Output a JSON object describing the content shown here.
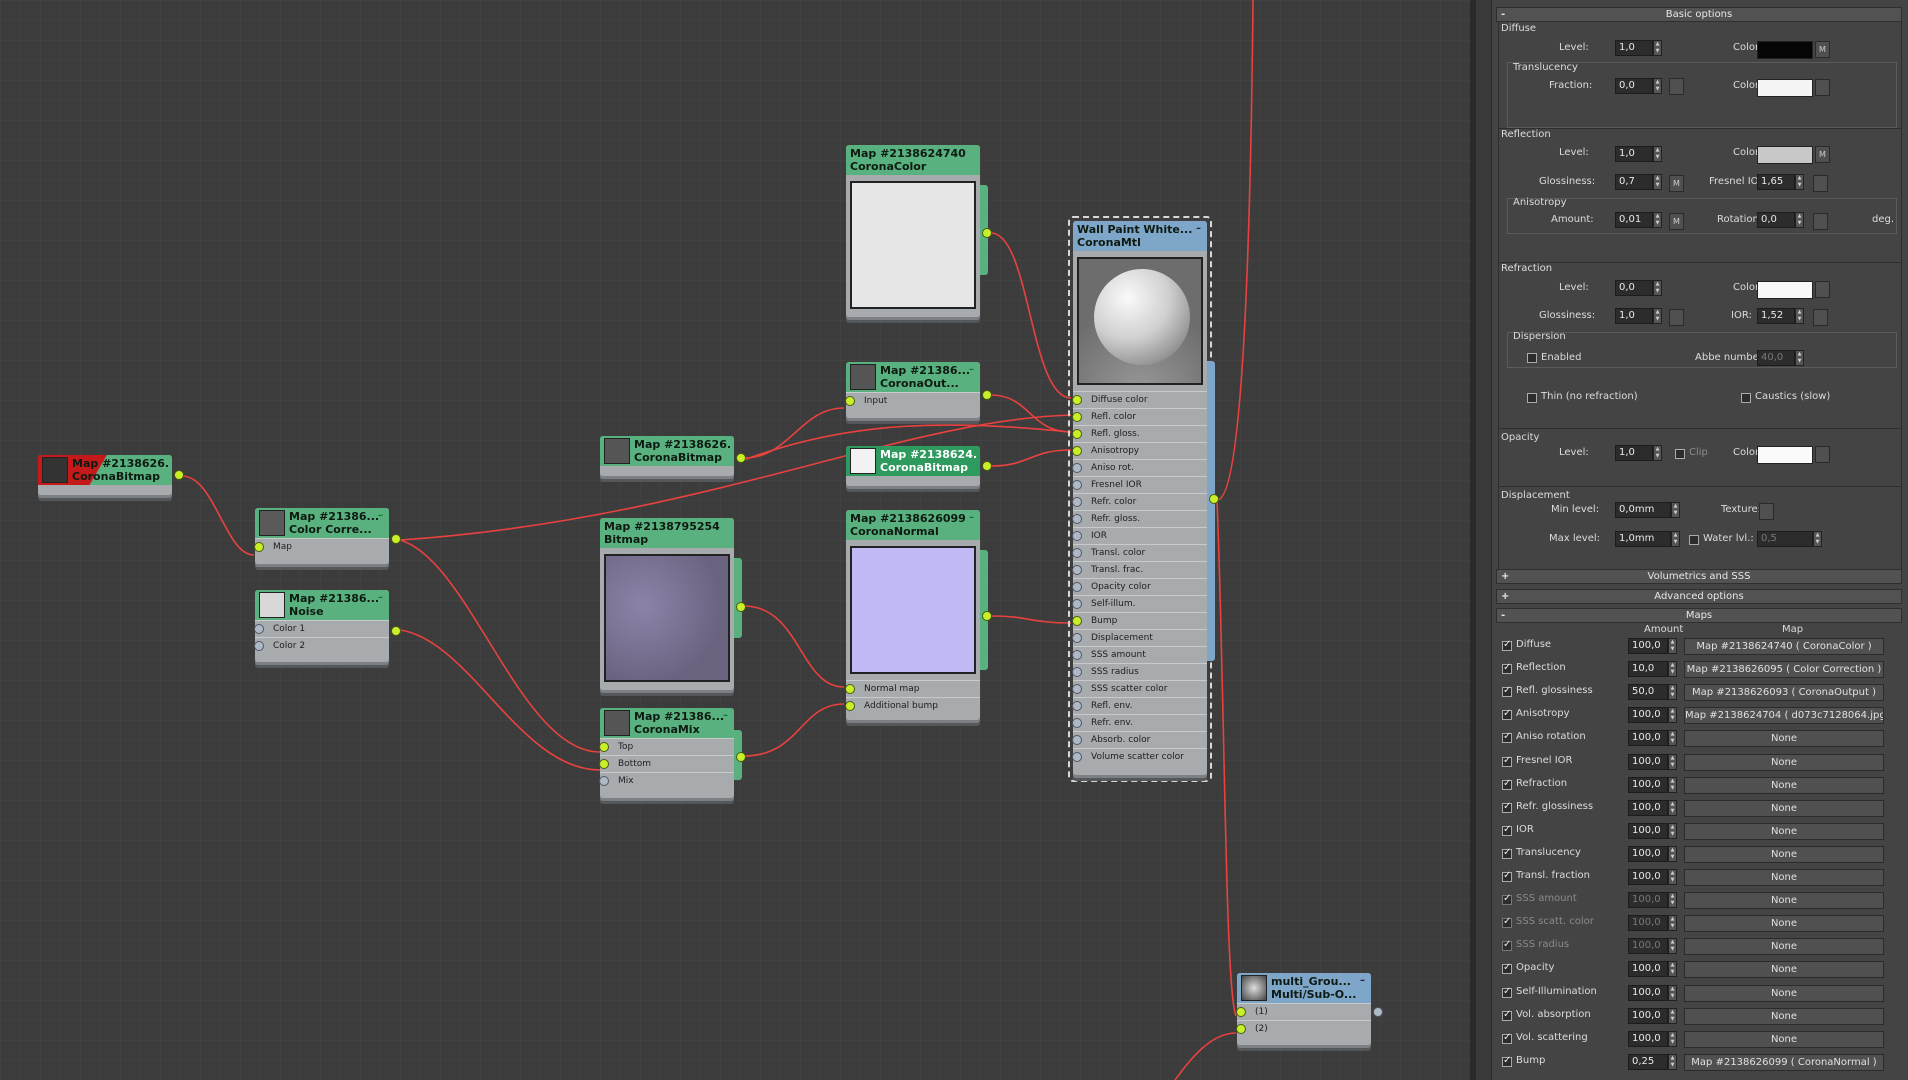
{
  "nodes": {
    "bitmap_red": {
      "title": "Map #2138626...",
      "subtitle": "CoronaBitmap"
    },
    "color_correction": {
      "title": "Map #21386...",
      "subtitle": "Color Corre...",
      "slots": [
        "Map"
      ]
    },
    "noise": {
      "title": "Map #21386...",
      "subtitle": "Noise",
      "slots": [
        "Color 1",
        "Color 2"
      ]
    },
    "bitmap_mid": {
      "title": "Map #2138626...",
      "subtitle": "CoronaBitmap"
    },
    "bitmap_big": {
      "title": "Map #2138795254",
      "subtitle": "Bitmap"
    },
    "corona_mix": {
      "title": "Map #21386...",
      "subtitle": "CoronaMix",
      "slots": [
        "Top",
        "Bottom",
        "Mix"
      ]
    },
    "corona_color": {
      "title": "Map #2138624740",
      "subtitle": "CoronaColor"
    },
    "corona_output": {
      "title": "Map #21386...",
      "subtitle": "CoronaOut...",
      "slots": [
        "Input"
      ]
    },
    "bitmap_selected": {
      "title": "Map #2138624...",
      "subtitle": "CoronaBitmap"
    },
    "corona_normal": {
      "title": "Map #2138626099",
      "subtitle": "CoronaNormal",
      "slots": [
        "Normal map",
        "Additional bump"
      ]
    },
    "material": {
      "title": "Wall Paint White...",
      "subtitle": "CoronaMtl",
      "slots": [
        "Diffuse color",
        "Refl. color",
        "Refl. gloss.",
        "Anisotropy",
        "Aniso rot.",
        "Fresnel IOR",
        "Refr. color",
        "Refr. gloss.",
        "IOR",
        "Transl. color",
        "Transl. frac.",
        "Opacity color",
        "Self-illum.",
        "Bump",
        "Displacement",
        "SSS amount",
        "SSS radius",
        "SSS scatter color",
        "Refl. env.",
        "Refr. env.",
        "Absorb. color",
        "Volume scatter color"
      ]
    },
    "multi": {
      "title": "multi_Grou...",
      "subtitle": "Multi/Sub-O...",
      "slots": [
        "(1)",
        "(2)"
      ]
    }
  },
  "panel": {
    "basic_header": "Basic options",
    "diffuse": {
      "label": "Diffuse",
      "level_label": "Level:",
      "level": "1,0",
      "color_label": "Color:",
      "color": "#050505",
      "m": "M"
    },
    "translucency": {
      "label": "Translucency",
      "fraction_label": "Fraction:",
      "fraction": "0,0",
      "color_label": "Color:",
      "color": "#f4f4f4"
    },
    "reflection": {
      "label": "Reflection",
      "level_label": "Level:",
      "level": "1,0",
      "color_label": "Color:",
      "color": "#c8c8c8",
      "m": "M",
      "gloss_label": "Glossiness:",
      "gloss": "0,7",
      "gloss_m": "M",
      "fresnel_label": "Fresnel IOR:",
      "fresnel": "1,65"
    },
    "anisotropy": {
      "label": "Anisotropy",
      "amount_label": "Amount:",
      "amount": "0,01",
      "amount_m": "M",
      "rotation_label": "Rotation:",
      "rotation": "0,0",
      "deg": "deg."
    },
    "refraction": {
      "label": "Refraction",
      "level_label": "Level:",
      "level": "0,0",
      "color_label": "Color:",
      "color": "#f8f8f8",
      "gloss_label": "Glossiness:",
      "gloss": "1,0",
      "ior_label": "IOR:",
      "ior": "1,52"
    },
    "dispersion": {
      "label": "Dispersion",
      "enabled_label": "Enabled",
      "abbe_label": "Abbe number:",
      "abbe": "40,0"
    },
    "thin_label": "Thin (no refraction)",
    "caustics_label": "Caustics (slow)",
    "opacity": {
      "label": "Opacity",
      "level_label": "Level:",
      "level": "1,0",
      "clip_label": "Clip",
      "color_label": "Color:",
      "color": "#fafafa"
    },
    "displacement": {
      "label": "Displacement",
      "min_label": "Min level:",
      "min": "0,0mm",
      "texture_label": "Texture:",
      "max_label": "Max level:",
      "max": "1,0mm",
      "water_label": "Water lvl.:",
      "water": "0,5"
    },
    "volumetrics_header": "Volumetrics and SSS",
    "advanced_header": "Advanced options",
    "maps_header": "Maps",
    "maps_col_amount": "Amount",
    "maps_col_map": "Map",
    "plus": "+",
    "minus": "-",
    "maps": [
      {
        "name": "Diffuse",
        "amount": "100,0",
        "map": "Map #2138624740  ( CoronaColor )",
        "on": true
      },
      {
        "name": "Reflection",
        "amount": "10,0",
        "map": "Map #2138626095  ( Color Correction )",
        "on": true
      },
      {
        "name": "Refl. glossiness",
        "amount": "50,0",
        "map": "Map #2138626093  ( CoronaOutput )",
        "on": true
      },
      {
        "name": "Anisotropy",
        "amount": "100,0",
        "map": "Map #2138624704 ( d073c7128064.jpg )",
        "on": true
      },
      {
        "name": "Aniso rotation",
        "amount": "100,0",
        "map": "None",
        "on": true
      },
      {
        "name": "Fresnel IOR",
        "amount": "100,0",
        "map": "None",
        "on": true
      },
      {
        "name": "Refraction",
        "amount": "100,0",
        "map": "None",
        "on": true
      },
      {
        "name": "Refr. glossiness",
        "amount": "100,0",
        "map": "None",
        "on": true
      },
      {
        "name": "IOR",
        "amount": "100,0",
        "map": "None",
        "on": true
      },
      {
        "name": "Translucency",
        "amount": "100,0",
        "map": "None",
        "on": true
      },
      {
        "name": "Transl. fraction",
        "amount": "100,0",
        "map": "None",
        "on": true
      },
      {
        "name": "SSS amount",
        "amount": "100,0",
        "map": "None",
        "on": true,
        "dis": true
      },
      {
        "name": "SSS scatt. color",
        "amount": "100,0",
        "map": "None",
        "on": true,
        "dis": true
      },
      {
        "name": "SSS radius",
        "amount": "100,0",
        "map": "None",
        "on": true,
        "dis": true
      },
      {
        "name": "Opacity",
        "amount": "100,0",
        "map": "None",
        "on": true
      },
      {
        "name": "Self-Illumination",
        "amount": "100,0",
        "map": "None",
        "on": true
      },
      {
        "name": "Vol. absorption",
        "amount": "100,0",
        "map": "None",
        "on": true
      },
      {
        "name": "Vol. scattering",
        "amount": "100,0",
        "map": "None",
        "on": true
      },
      {
        "name": "Bump",
        "amount": "0,25",
        "map": "Map #2138626099  ( CoronaNormal )",
        "on": true
      }
    ]
  }
}
